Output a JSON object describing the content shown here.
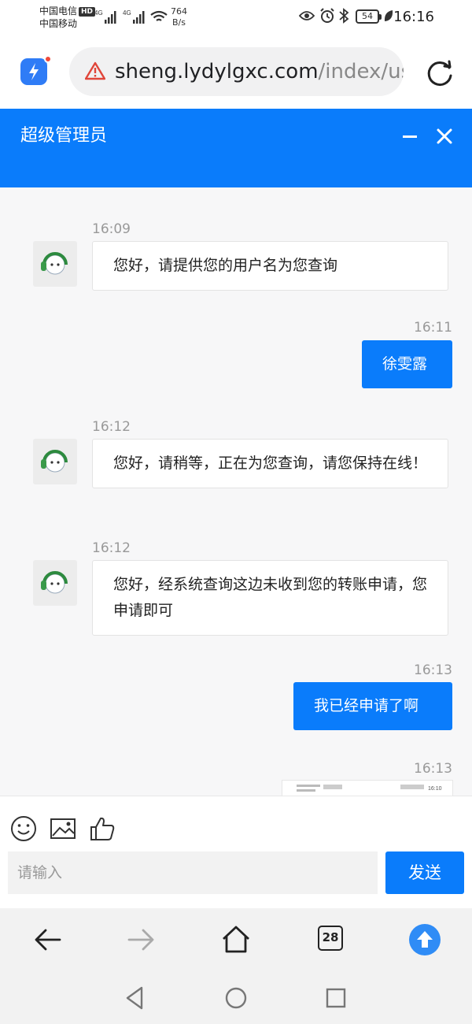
{
  "status_bar": {
    "carrier_1": "中国电信",
    "carrier_1_badge": "HD",
    "carrier_2": "中国移动",
    "network_1": "4G",
    "network_2": "4G",
    "net_speed_value": "764",
    "net_speed_unit": "B/s",
    "battery": "54",
    "time": "16:16"
  },
  "browser": {
    "url_host": "sheng.lydylgxc.com",
    "url_path": "/index/use",
    "tab_count": "28"
  },
  "chat": {
    "title": "超级管理员",
    "messages": [
      {
        "time": "16:09",
        "from": "agent",
        "text": "您好，请提供您的用户名为您查询"
      },
      {
        "time": "16:11",
        "from": "user",
        "text": "徐雯露"
      },
      {
        "time": "16:12",
        "from": "agent",
        "text": "您好，请稍等，正在为您查询，请您保持在线！"
      },
      {
        "time": "16:12",
        "from": "agent",
        "text": "您好，经系统查询这边未收到您的转账申请，您申请即可"
      },
      {
        "time": "16:13",
        "from": "user",
        "text": "我已经申请了啊"
      },
      {
        "time": "16:13",
        "from": "user",
        "text": ""
      }
    ],
    "thumb_status_time": "16:10"
  },
  "composer": {
    "placeholder": "请输入",
    "send_label": "发送"
  },
  "colors": {
    "accent": "#0a7cfb",
    "header_bg": "#0a7cfb",
    "warning": "#e0463a"
  }
}
